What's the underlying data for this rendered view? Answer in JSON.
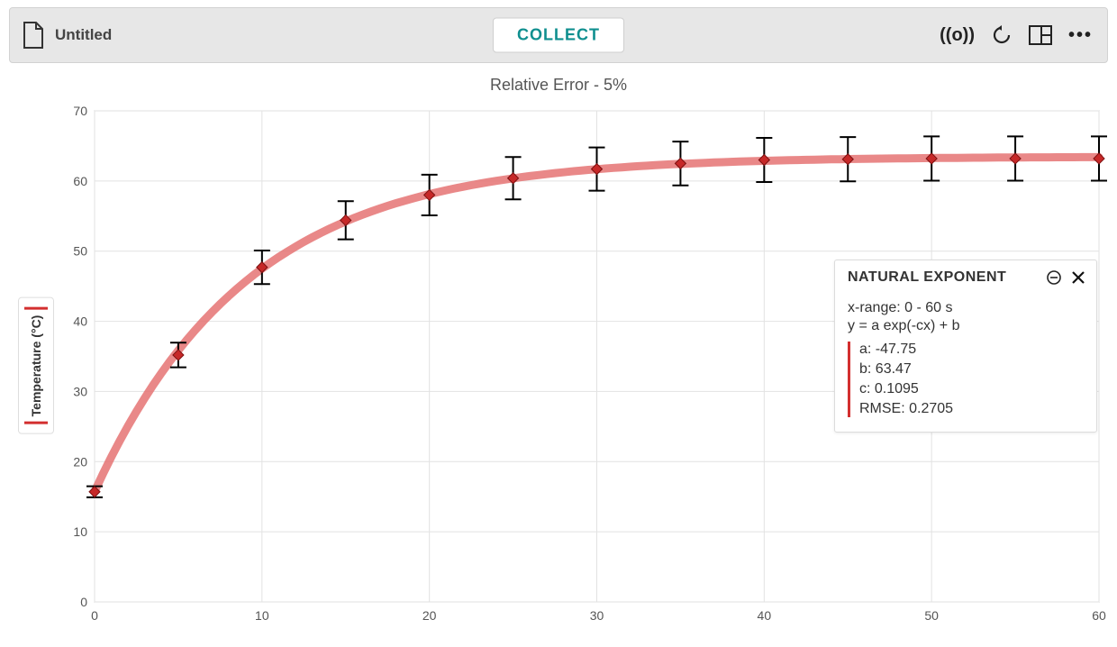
{
  "toolbar": {
    "file_title": "Untitled",
    "collect_label": "COLLECT"
  },
  "chart_title": "Relative Error - 5%",
  "y_axis_label": "Temperature (°C)",
  "fit_panel": {
    "title": "NATURAL EXPONENT",
    "xrange": "x-range: 0 - 60 s",
    "equation": "y = a exp(-cx) + b",
    "a": "a: -47.75",
    "b": "b: 63.47",
    "c": "c: 0.1095",
    "rmse": "RMSE: 0.2705"
  },
  "chart_data": {
    "type": "scatter",
    "title": "Relative Error - 5%",
    "xlabel": "",
    "ylabel": "Temperature (°C)",
    "x_ticks": [
      0,
      10,
      20,
      30,
      40,
      50,
      60
    ],
    "y_ticks": [
      0,
      10,
      20,
      30,
      40,
      50,
      60,
      70
    ],
    "xlim": [
      0,
      60
    ],
    "ylim": [
      0,
      70
    ],
    "error_type": "relative",
    "error_percent": 5,
    "series": [
      {
        "name": "Temperature",
        "color": "#d32f2f",
        "x": [
          0,
          5,
          10,
          15,
          20,
          25,
          30,
          35,
          40,
          45,
          50,
          55,
          60
        ],
        "y": [
          15.7,
          35.2,
          47.7,
          54.4,
          58.0,
          60.4,
          61.7,
          62.5,
          63.0,
          63.1,
          63.2,
          63.2,
          63.2
        ]
      }
    ],
    "fit": {
      "model": "natural_exponent",
      "equation": "y = a*exp(-c*x) + b",
      "a": -47.75,
      "b": 63.47,
      "c": 0.1095,
      "rmse": 0.2705,
      "x_range": [
        0,
        60
      ]
    }
  }
}
